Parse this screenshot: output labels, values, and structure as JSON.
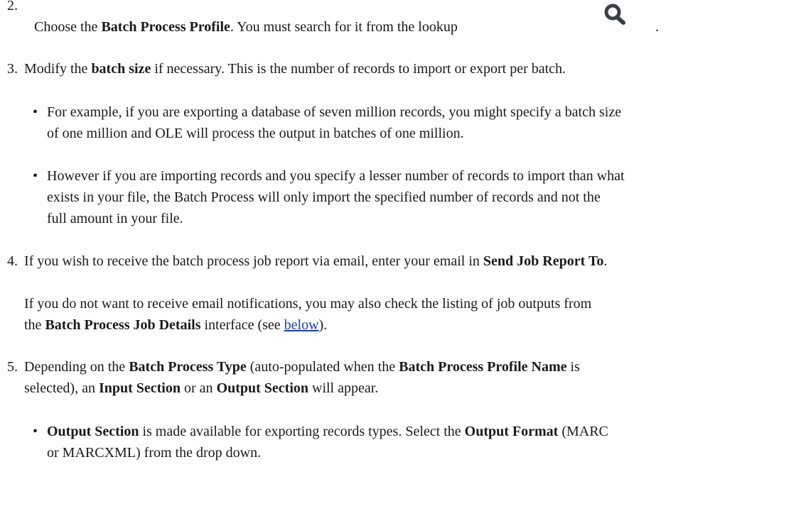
{
  "steps": {
    "s2": {
      "num": "2.",
      "t1": "Choose the ",
      "b1": "Batch Process Profile",
      "t2": ". You must search for it from the lookup",
      "end": ".",
      "icon": "magnifier-icon"
    },
    "s3": {
      "num": "3.",
      "t1": "Modify the ",
      "b1": "batch size",
      "t2": " if necessary. This is the number of records to import or export per batch.",
      "bullets": [
        {
          "l1": "For example, if you are exporting a database of seven million records, you might specify a batch size",
          "l2": "of one million and OLE will process the output in batches of one million."
        },
        {
          "l1": "However if you are importing records and you specify a lesser number of records to import than what",
          "l2": "exists in your file, the Batch Process will only import the specified number of records and not the",
          "l3": "full amount in your file."
        }
      ]
    },
    "s4": {
      "num": "4.",
      "t1": "If you wish to receive the batch process job report via email, enter your email in ",
      "b1": "Send Job Report To",
      "t2": ".",
      "p2_t1": "If you do not want to receive email notifications, you may also check the listing of job outputs from",
      "p2_t2": "the ",
      "p2_b1": "Batch Process Job Details",
      "p2_t3": " interface (see ",
      "p2_link": "below",
      "p2_t4": ")."
    },
    "s5": {
      "num": "5.",
      "t1": "Depending on the ",
      "b1": "Batch Process Type",
      "t2": " (auto-populated when the ",
      "b2": "Batch Process Profile Name",
      "t3": " is",
      "l2_t1": "selected), an ",
      "l2_b1": "Input Section",
      "l2_t2": " or an ",
      "l2_b2": "Output Section",
      "l2_t3": " will appear.",
      "bullets": [
        {
          "b1": "Output Section",
          "t1": " is made available for exporting records types. Select the ",
          "b2": "Output Format",
          "t2": " (MARC",
          "l2": "or MARCXML) from the drop down."
        }
      ]
    }
  },
  "colors": {
    "text": "#1a1a1a",
    "link": "#1a3db8",
    "icon": "#3a3f45"
  }
}
